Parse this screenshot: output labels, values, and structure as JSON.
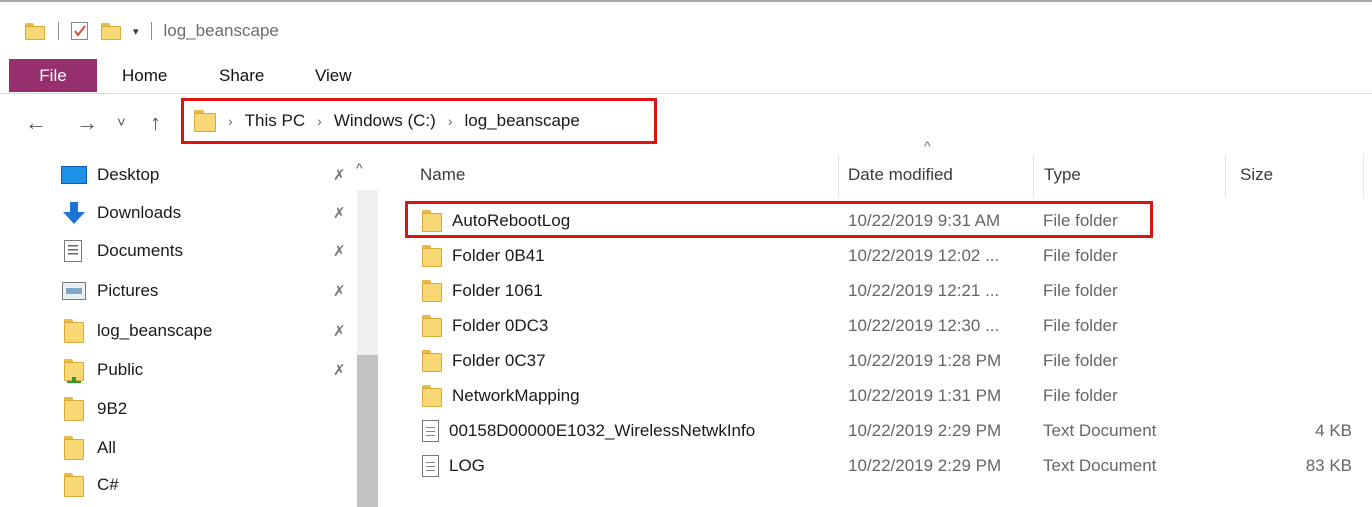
{
  "window": {
    "title": "log_beanscape"
  },
  "ribbon": {
    "tabs": [
      "File",
      "Home",
      "Share",
      "View"
    ]
  },
  "address": {
    "crumbs": [
      "This PC",
      "Windows (C:)",
      "log_beanscape"
    ],
    "separator": "›"
  },
  "nav_buttons": {
    "back": "←",
    "forward": "→",
    "recent": "˅",
    "up": "↑"
  },
  "sidebar": {
    "items": [
      {
        "label": "Desktop",
        "icon": "desktop-icon",
        "pinned": true
      },
      {
        "label": "Downloads",
        "icon": "download-arrow-icon",
        "pinned": true
      },
      {
        "label": "Documents",
        "icon": "documents-icon",
        "pinned": true
      },
      {
        "label": "Pictures",
        "icon": "pictures-icon",
        "pinned": true
      },
      {
        "label": "log_beanscape",
        "icon": "folder-icon",
        "pinned": true
      },
      {
        "label": "Public",
        "icon": "public-folder-icon",
        "pinned": true
      },
      {
        "label": "9B2",
        "icon": "folder-icon",
        "pinned": false
      },
      {
        "label": "All",
        "icon": "folder-icon",
        "pinned": false
      },
      {
        "label": "C#",
        "icon": "folder-icon",
        "pinned": false
      }
    ]
  },
  "columns": {
    "name": "Name",
    "date": "Date modified",
    "type": "Type",
    "size": "Size"
  },
  "files": [
    {
      "name": "AutoRebootLog",
      "date": "10/22/2019 9:31 AM",
      "type": "File folder",
      "size": "",
      "kind": "folder"
    },
    {
      "name": "Folder 0B41",
      "date": "10/22/2019 12:02 ...",
      "type": "File folder",
      "size": "",
      "kind": "folder"
    },
    {
      "name": "Folder 1061",
      "date": "10/22/2019 12:21 ...",
      "type": "File folder",
      "size": "",
      "kind": "folder"
    },
    {
      "name": "Folder 0DC3",
      "date": "10/22/2019 12:30 ...",
      "type": "File folder",
      "size": "",
      "kind": "folder"
    },
    {
      "name": "Folder 0C37",
      "date": "10/22/2019 1:28 PM",
      "type": "File folder",
      "size": "",
      "kind": "folder"
    },
    {
      "name": "NetworkMapping",
      "date": "10/22/2019 1:31 PM",
      "type": "File folder",
      "size": "",
      "kind": "folder"
    },
    {
      "name": "00158D00000E1032_WirelessNetwkInfo",
      "date": "10/22/2019 2:29 PM",
      "type": "Text Document",
      "size": "4 KB",
      "kind": "text"
    },
    {
      "name": "LOG",
      "date": "10/22/2019 2:29 PM",
      "type": "Text Document",
      "size": "83 KB",
      "kind": "text"
    }
  ],
  "colors": {
    "file_tab": "#972f6f",
    "highlight": "#e01313",
    "folder": "#f8d775"
  }
}
